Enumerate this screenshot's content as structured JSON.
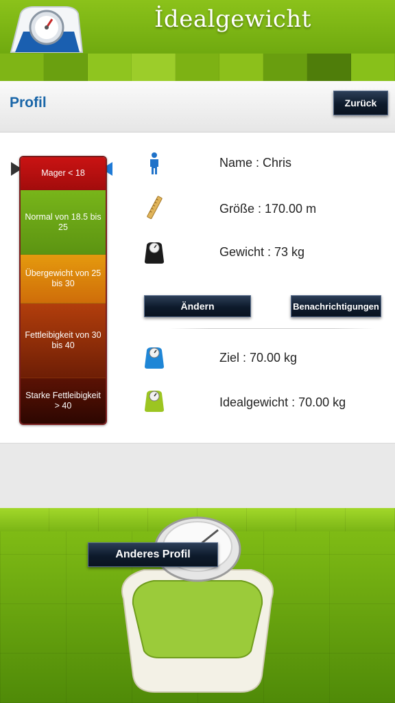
{
  "header": {
    "title": "İdealgewicht",
    "logo_icon": "scale-logo-icon"
  },
  "subbar": {
    "title": "Profil",
    "back_label": "Zurück"
  },
  "bmi_scale": {
    "segments": [
      {
        "label": "Mager < 18",
        "color": "#c01010"
      },
      {
        "label": "Normal von 18.5 bis 25",
        "color": "#6aa316"
      },
      {
        "label": "Übergewicht von 25 bis 30",
        "color": "#dd8a0c"
      },
      {
        "label": "Fettleibigkeit von 30 bis 40",
        "color": "#8e2c08"
      },
      {
        "label": "Starke Fettleibigkeit > 40",
        "color": "#3d0b02"
      }
    ],
    "current_segment_index": 0
  },
  "profile": {
    "name": "Name : Chris",
    "height": "Größe : 170.00 m",
    "weight": "Gewicht : 73 kg",
    "edit_label": "Ändern",
    "notifications_label": "Benachrichtigungen",
    "goal": "Ziel : 70.00 kg",
    "ideal": "Idealgewicht : 70.00 kg"
  },
  "footer": {
    "other_profile_label": "Anderes Profil"
  },
  "colors": {
    "accent_blue": "#1a66a8",
    "header_green": "#7ab415",
    "button_dark": "#0d1a2b"
  }
}
